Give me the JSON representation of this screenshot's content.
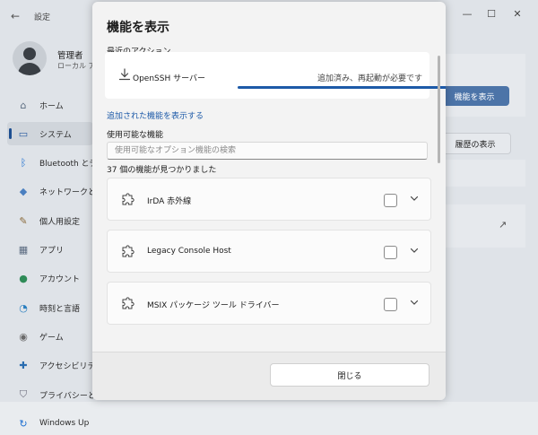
{
  "settings": {
    "window_title": "設定",
    "user": {
      "name": "管理者",
      "role": "ローカル ア"
    },
    "nav": [
      {
        "label": "ホーム",
        "icon": "home-icon",
        "active": false
      },
      {
        "label": "システム",
        "icon": "monitor-icon",
        "active": true
      },
      {
        "label": "Bluetooth とデ",
        "icon": "bluetooth-icon",
        "active": false
      },
      {
        "label": "ネットワークとイ",
        "icon": "wifi-icon",
        "active": false
      },
      {
        "label": "個人用設定",
        "icon": "brush-icon",
        "active": false
      },
      {
        "label": "アプリ",
        "icon": "apps-icon",
        "active": false
      },
      {
        "label": "アカウント",
        "icon": "person-icon",
        "active": false
      },
      {
        "label": "時刻と言語",
        "icon": "globe-clock-icon",
        "active": false
      },
      {
        "label": "ゲーム",
        "icon": "gamepad-icon",
        "active": false
      },
      {
        "label": "アクセシビリティ",
        "icon": "accessibility-icon",
        "active": false
      },
      {
        "label": "プライバシーとセ",
        "icon": "shield-icon",
        "active": false
      },
      {
        "label": "Windows Up",
        "icon": "refresh-icon",
        "active": false
      }
    ],
    "primary_button": "機能を表示",
    "history_button": "履歴の表示"
  },
  "dialog": {
    "title": "機能を表示",
    "recent_label": "最近のアクション",
    "recent_item": {
      "name": "OpenSSH サーバー",
      "status": "追加済み、再起動が必要です",
      "progress": 1.0
    },
    "show_added_link": "追加された機能を表示する",
    "available_label": "使用可能な機能",
    "search_placeholder": "使用可能なオプション機能の検索",
    "count_text": "37 個の機能が見つかりました",
    "features": [
      {
        "name": "IrDA 赤外線"
      },
      {
        "name": "Legacy Console Host"
      },
      {
        "name": "MSIX パッケージ ツール ドライバー"
      }
    ],
    "close_button": "閉じる"
  },
  "colors": {
    "accent": "#1d5aa8",
    "primary_button": "#4c74a8"
  }
}
